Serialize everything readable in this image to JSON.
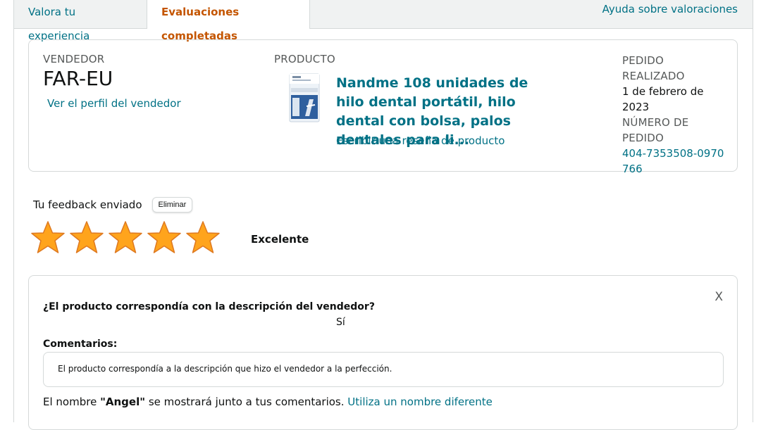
{
  "tabs": [
    {
      "label": "Valora tu experiencia"
    },
    {
      "label": "Evaluaciones completadas"
    }
  ],
  "help_link": "Ayuda sobre valoraciones",
  "order": {
    "seller_label": "VENDEDOR",
    "seller_name": "FAR-EU",
    "seller_link": "Ver el perfil del vendedor",
    "product_label": "PRODUCTO",
    "product_title": "Nandme 108 unidades de hilo dental portátil, hilo dental con bolsa, palos dentales para li...",
    "product_image_icon": "dental-floss-package-icon",
    "review_link": "Escribir una reseña de producto",
    "placed_label": "PEDIDO REALIZADO",
    "placed_date": "1 de febrero de 2023",
    "number_label": "NÚMERO DE PEDIDO",
    "number_value": "404-7353508-0970766"
  },
  "feedback": {
    "sent_text": "Tu feedback enviado",
    "delete_label": "Eliminar",
    "stars": 5,
    "rating_label": "Excelente"
  },
  "detail": {
    "close": "X",
    "question": "¿El producto correspondía con la descripción del vendedor?",
    "answer": "Sí",
    "comments_label": "Comentarios:",
    "comment": "El producto correspondía a la descripción que hizo el vendedor a la perfección.",
    "name_prefix": "El nombre",
    "name_value": "\"Angel\"",
    "name_suffix": "se mostrará junto a tus comentarios.",
    "name_link": "Utiliza un nombre diferente"
  },
  "colors": {
    "link": "#007185",
    "active_tab": "#c45500",
    "star": "#ffa41c"
  }
}
